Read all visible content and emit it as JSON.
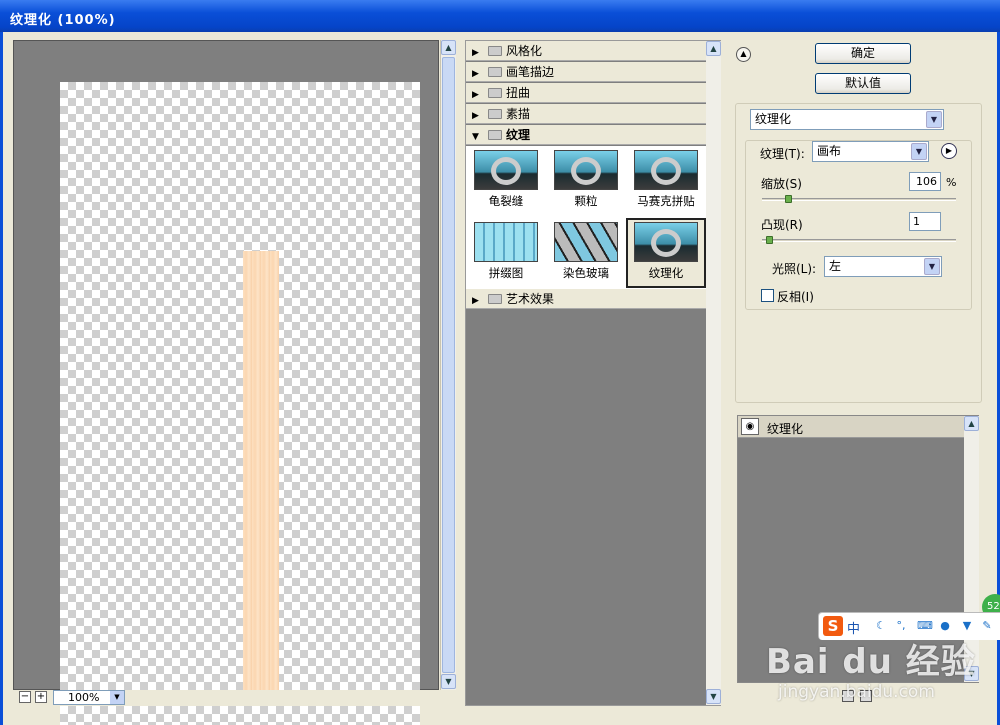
{
  "window": {
    "title": "纹理化 (100%)"
  },
  "preview": {
    "zoom_value": "100%",
    "zoom_out_label": "−",
    "zoom_in_label": "+"
  },
  "gallery": {
    "categories_top": [
      {
        "label": "风格化",
        "expanded": false
      },
      {
        "label": "画笔描边",
        "expanded": false
      },
      {
        "label": "扭曲",
        "expanded": false
      },
      {
        "label": "素描",
        "expanded": false
      },
      {
        "label": "纹理",
        "expanded": true
      }
    ],
    "thumbnails": [
      {
        "label": "龟裂缝",
        "selected": false
      },
      {
        "label": "颗粒",
        "selected": false
      },
      {
        "label": "马赛克拼贴",
        "selected": false
      },
      {
        "label": "拼缀图",
        "selected": false
      },
      {
        "label": "染色玻璃",
        "selected": false
      },
      {
        "label": "纹理化",
        "selected": true
      }
    ],
    "categories_bottom": [
      {
        "label": "艺术效果",
        "expanded": false
      }
    ]
  },
  "buttons": {
    "ok": "确定",
    "default": "默认值"
  },
  "settings": {
    "filter_select": "纹理化",
    "texture_label": "纹理(T):",
    "texture_value": "画布",
    "scaling_label": "缩放(S)",
    "scaling_value": "106",
    "scaling_unit": "%",
    "scaling_fraction": 0.12,
    "relief_label": "凸现(R)",
    "relief_value": "1",
    "relief_fraction": 0.02,
    "light_label": "光照(L):",
    "light_value": "左",
    "invert_label": "反相(I)",
    "invert_checked": false
  },
  "layers": {
    "items": [
      {
        "label": "纹理化",
        "visible": true
      }
    ]
  },
  "overlay": {
    "ime_logo": "S",
    "ime_mode": "中",
    "badge": "52",
    "watermark_main": "Bai du 经验",
    "watermark_sub": "jingyan.baidu.com"
  },
  "colors": {
    "titlebar": "#0a4fd8",
    "preview_bg": "#7f7f7f",
    "wood": "#fbd6b0",
    "ime_logo": "#f25a0f"
  }
}
